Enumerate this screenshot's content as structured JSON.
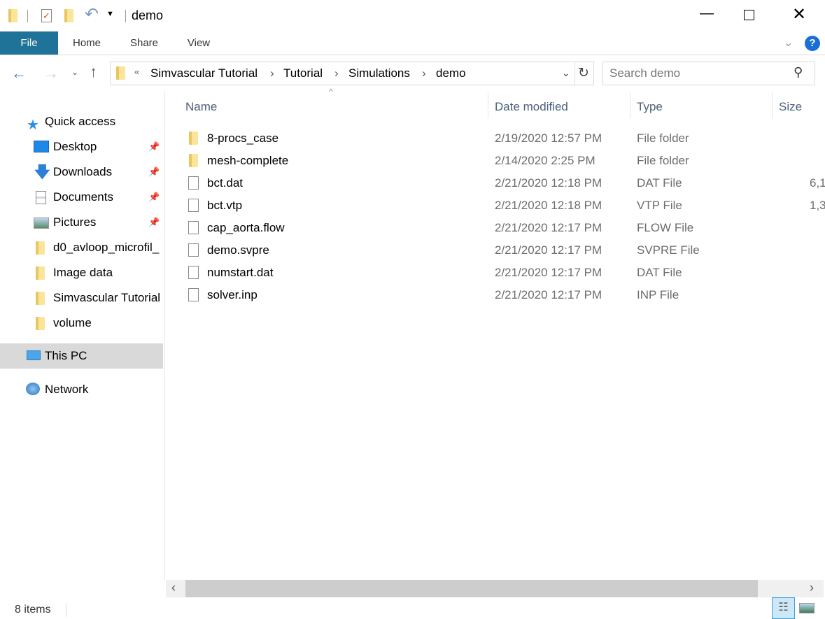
{
  "window": {
    "title": "demo"
  },
  "ribbon": {
    "tabs": [
      "File",
      "Home",
      "Share",
      "View"
    ]
  },
  "address": {
    "crumbs": [
      "Simvascular Tutorial",
      "Tutorial",
      "Simulations",
      "demo"
    ],
    "overflow": "«"
  },
  "search": {
    "placeholder": "Search demo"
  },
  "nav": {
    "quick_access": "Quick access",
    "items": [
      {
        "label": "Desktop",
        "icon": "desktop-icon",
        "pinned": true
      },
      {
        "label": "Downloads",
        "icon": "download-icon",
        "pinned": true
      },
      {
        "label": "Documents",
        "icon": "documents-icon",
        "pinned": true
      },
      {
        "label": "Pictures",
        "icon": "pictures-icon",
        "pinned": true
      },
      {
        "label": "d0_avloop_microfil_",
        "icon": "folder-icon",
        "pinned": false
      },
      {
        "label": "Image data",
        "icon": "folder-icon",
        "pinned": false
      },
      {
        "label": "Simvascular Tutorial",
        "icon": "folder-icon",
        "pinned": false
      },
      {
        "label": "volume",
        "icon": "folder-icon",
        "pinned": false
      }
    ],
    "this_pc": "This PC",
    "network": "Network"
  },
  "columns": [
    "Name",
    "Date modified",
    "Type",
    "Size"
  ],
  "files": [
    {
      "name": "8-procs_case",
      "date": "2/19/2020 12:57 PM",
      "type": "File folder",
      "size": "",
      "icon": "folder"
    },
    {
      "name": "mesh-complete",
      "date": "2/14/2020 2:25 PM",
      "type": "File folder",
      "size": "",
      "icon": "folder"
    },
    {
      "name": "bct.dat",
      "date": "2/21/2020 12:18 PM",
      "type": "DAT File",
      "size": "6,1",
      "icon": "file"
    },
    {
      "name": "bct.vtp",
      "date": "2/21/2020 12:18 PM",
      "type": "VTP File",
      "size": "1,3",
      "icon": "file"
    },
    {
      "name": "cap_aorta.flow",
      "date": "2/21/2020 12:17 PM",
      "type": "FLOW File",
      "size": "",
      "icon": "file"
    },
    {
      "name": "demo.svpre",
      "date": "2/21/2020 12:17 PM",
      "type": "SVPRE File",
      "size": "",
      "icon": "file"
    },
    {
      "name": "numstart.dat",
      "date": "2/21/2020 12:17 PM",
      "type": "DAT File",
      "size": "",
      "icon": "file"
    },
    {
      "name": "solver.inp",
      "date": "2/21/2020 12:17 PM",
      "type": "INP File",
      "size": "",
      "icon": "file"
    }
  ],
  "status": {
    "count": "8 items"
  },
  "colors": {
    "accent": "#1f7399",
    "selected_nav": "#d9d9d9",
    "header_text": "#4c607a"
  }
}
